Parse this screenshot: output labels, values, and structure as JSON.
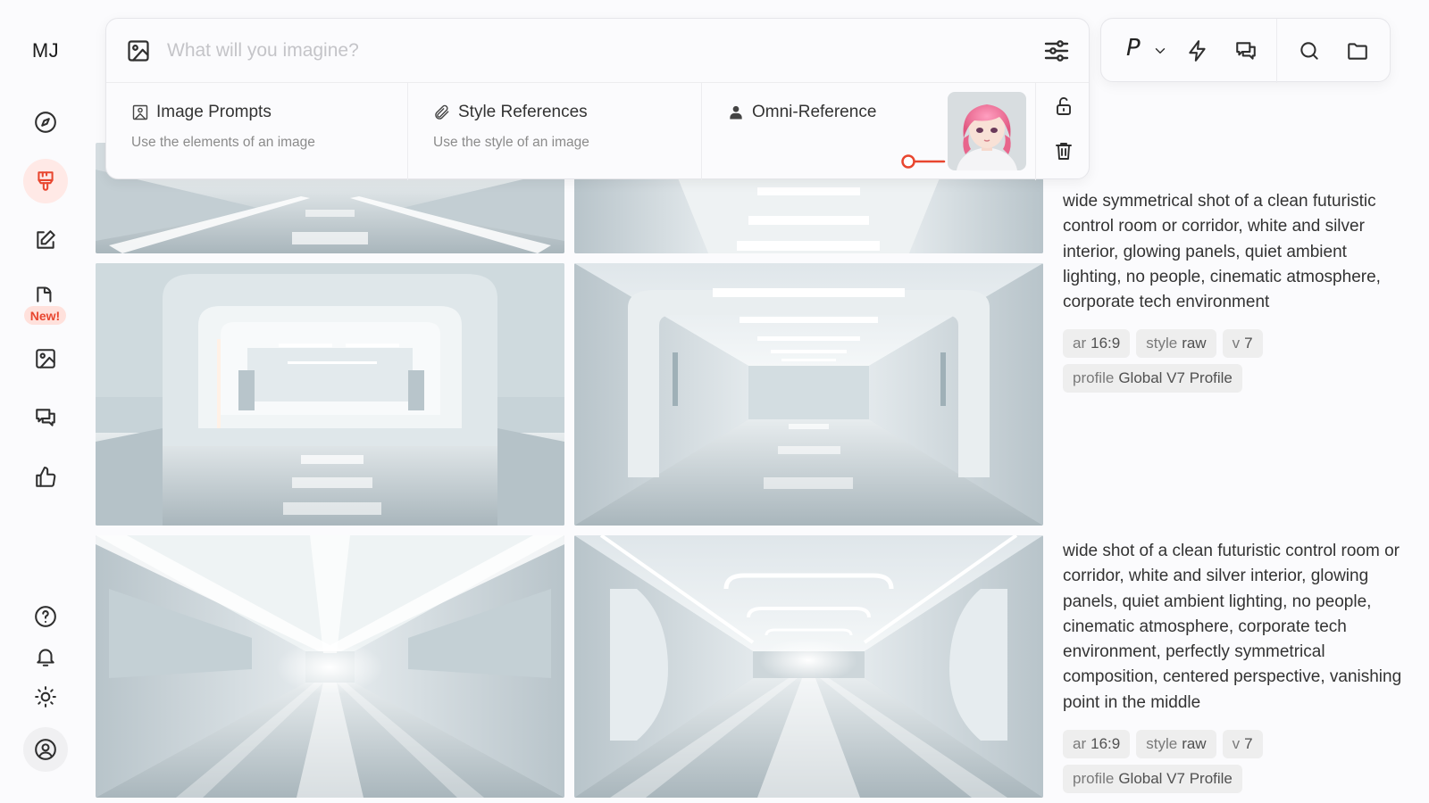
{
  "sidebar": {
    "logo": "MJ",
    "items": [
      {
        "name": "explore",
        "icon": "compass-icon"
      },
      {
        "name": "create",
        "icon": "paint-brush-icon",
        "active": true
      },
      {
        "name": "edit",
        "icon": "edit-icon"
      },
      {
        "name": "new-feature",
        "icon": "video-icon",
        "badge": "New!"
      },
      {
        "name": "organize",
        "icon": "image-icon"
      },
      {
        "name": "chat",
        "icon": "chat-icon"
      },
      {
        "name": "personalize",
        "icon": "thumbs-up-icon"
      }
    ],
    "bottom_items": [
      {
        "name": "help",
        "icon": "help-icon"
      },
      {
        "name": "notifications",
        "icon": "bell-icon"
      },
      {
        "name": "theme",
        "icon": "sun-icon"
      },
      {
        "name": "account",
        "icon": "user-circle-icon"
      }
    ]
  },
  "imagine": {
    "placeholder": "What will you imagine?",
    "value": "",
    "references": [
      {
        "title": "Image Prompts",
        "subtitle": "Use the elements of an image",
        "icon": "image-prompt-icon"
      },
      {
        "title": "Style References",
        "subtitle": "Use the style of an image",
        "icon": "paperclip-icon"
      },
      {
        "title": "Omni-Reference",
        "subtitle": "",
        "icon": "person-icon"
      }
    ],
    "omni_weight_level": 0.0
  },
  "toolbar": {
    "personalization_label": "P",
    "icons": [
      "chevron-down-icon",
      "lightning-icon",
      "chat-icon",
      "search-icon",
      "folder-icon"
    ]
  },
  "jobs": [
    {
      "prompt": "wide symmetrical shot of a clean futuristic control room or corridor, white and silver interior, glowing panels, quiet ambient lighting, no people, cinematic atmosphere, corporate tech environment",
      "tags": [
        {
          "key": "ar",
          "value": "16:9"
        },
        {
          "key": "style",
          "value": "raw"
        },
        {
          "key": "v",
          "value": "7"
        },
        {
          "key": "profile",
          "value": "Global V7 Profile"
        }
      ]
    },
    {
      "prompt": "wide shot of a clean futuristic control room or corridor, white and silver interior, glowing panels, quiet ambient lighting, no people, cinematic atmosphere, corporate tech environment, perfectly symmetrical composition, centered perspective, vanishing point in the middle",
      "tags": [
        {
          "key": "ar",
          "value": "16:9"
        },
        {
          "key": "style",
          "value": "raw"
        },
        {
          "key": "v",
          "value": "7"
        },
        {
          "key": "profile",
          "value": "Global V7 Profile"
        }
      ]
    }
  ],
  "colors": {
    "accent": "#e8462f",
    "accent_soft": "#ffe9e6",
    "background": "#fbfbfd"
  }
}
